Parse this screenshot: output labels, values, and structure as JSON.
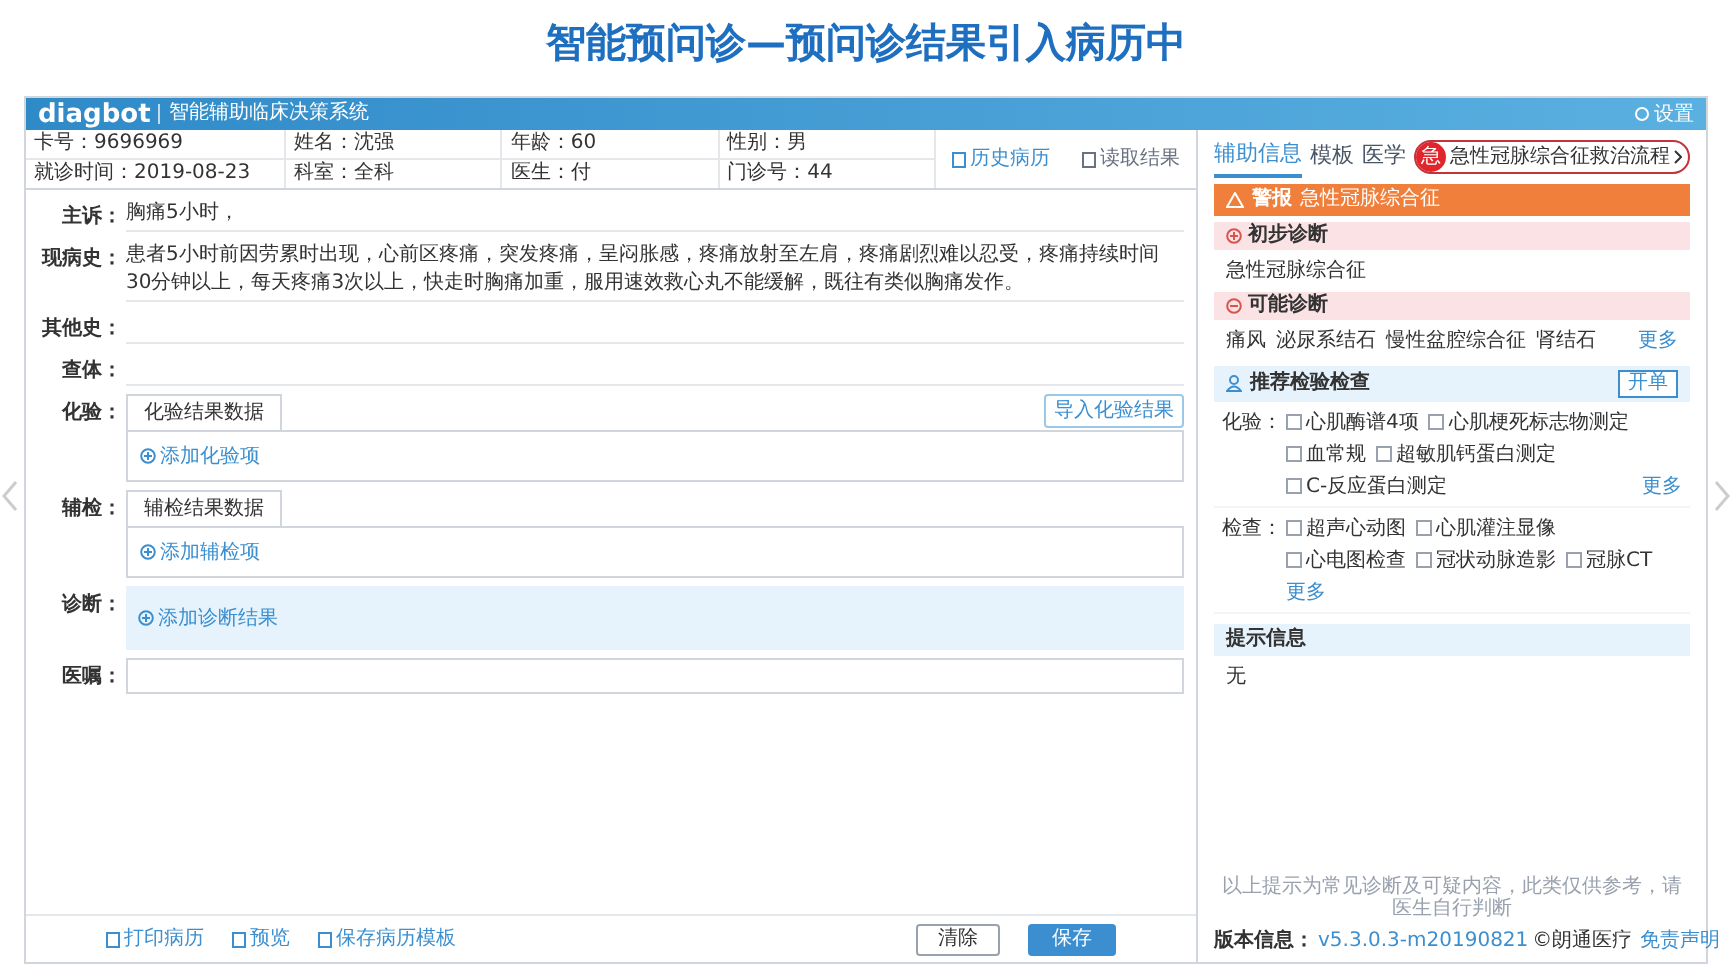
{
  "slide_title": "智能预问诊—预问诊结果引入病历中",
  "window": {
    "logo": "diagbot",
    "subtitle": "智能辅助临床决策系统",
    "settings": "设置"
  },
  "patient_info": [
    [
      "卡号：9696969",
      "姓名：沈强",
      "年龄：60",
      "性别：男"
    ],
    [
      "就诊时间：2019-08-23",
      "科室：全科",
      "医生：付",
      "门诊号：44"
    ]
  ],
  "header_buttons": [
    {
      "label": "历史病历",
      "disabled": false
    },
    {
      "label": "读取结果",
      "disabled": true
    }
  ],
  "fields": [
    {
      "kind": "text",
      "label": "主诉：",
      "value": "胸痛5小时，"
    },
    {
      "kind": "text",
      "label": "现病史：",
      "value": "患者5小时前因劳累时出现，心前区疼痛，突发疼痛，呈闷胀感，疼痛放射至左肩，疼痛剧烈难以忍受，疼痛持续时间30分钟以上，每天疼痛3次以上，快走时胸痛加重，服用速效救心丸不能缓解，既往有类似胸痛发作。"
    },
    {
      "kind": "text",
      "label": "其他史："
    },
    {
      "kind": "text",
      "label": "查体："
    },
    {
      "kind": "tabbed",
      "label": "化验：",
      "tab": "化验结果数据",
      "add": "添加化验项",
      "action": "导入化验结果"
    },
    {
      "kind": "tabbed",
      "label": "辅检：",
      "tab": "辅检结果数据",
      "add": "添加辅检项"
    },
    {
      "kind": "diagnosis",
      "label": "诊断：",
      "add": "添加诊断结果"
    },
    {
      "kind": "input",
      "label": "医嘱："
    }
  ],
  "footer": {
    "links": [
      "打印病历",
      "预览",
      "保存病历模板"
    ],
    "clear": "清除",
    "save": "保存"
  },
  "side": {
    "tabs": [
      {
        "label": "辅助信息",
        "selected": true
      },
      {
        "label": "模板",
        "selected": false
      },
      {
        "label": "医学",
        "selected": false
      }
    ],
    "urgent_badge": "急",
    "pathway": "急性冠脉综合征救治流程",
    "alert": {
      "title": "警报",
      "text": "急性冠脉综合征"
    },
    "initial_diagnosis": {
      "title": "初步诊断",
      "items": [
        "急性冠脉综合征"
      ]
    },
    "possible_diagnosis": {
      "title": "可能诊断",
      "items": [
        "痛风",
        "泌尿系结石",
        "慢性盆腔综合征",
        "肾结石"
      ],
      "more": "更多"
    },
    "recommend": {
      "title": "推荐检验检查",
      "button": "开单",
      "groups": [
        {
          "label": "化验：",
          "items": [
            {
              "label": "心肌酶谱4项",
              "checked": false
            },
            {
              "label": "心肌梗死标志物测定",
              "checked": false
            },
            {
              "label": "血常规",
              "checked": false
            },
            {
              "label": "超敏肌钙蛋白测定",
              "checked": false
            },
            {
              "label": "C-反应蛋白测定",
              "checked": false
            }
          ],
          "more": "更多"
        },
        {
          "label": "检查：",
          "items": [
            {
              "label": "超声心动图",
              "checked": false
            },
            {
              "label": "心肌灌注显像",
              "checked": false
            },
            {
              "label": "心电图检查",
              "checked": false
            },
            {
              "label": "冠状动脉造影",
              "checked": false
            },
            {
              "label": "冠脉CT",
              "checked": false
            }
          ],
          "more": "更多"
        }
      ]
    },
    "hint": {
      "title": "提示信息",
      "text": "无"
    },
    "disclaimer": "以上提示为常见诊断及可疑内容，此类仅供参考，请医生自行判断",
    "version_label": "版本信息：",
    "version": "v5.3.0.3-m20190821",
    "company": "©朗通医疗",
    "legal": "免责声明"
  }
}
